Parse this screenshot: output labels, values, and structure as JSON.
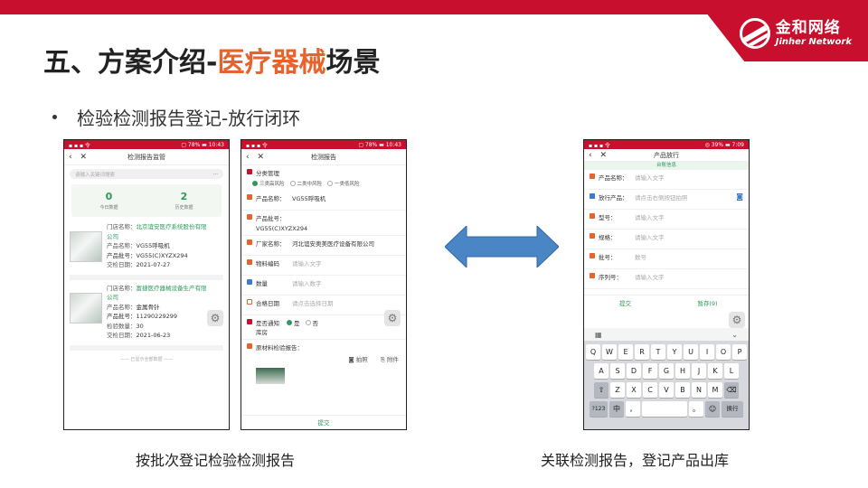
{
  "logo": {
    "cn": "金和网络",
    "en": "Jinher Network"
  },
  "title": {
    "prefix": "五、方案介绍-",
    "accent": "医疗器械",
    "suffix": "场景"
  },
  "bullet": "检验检测报告登记-放行闭环",
  "phone1": {
    "status_left": "▪ ▪ ▪ 令",
    "status_right": "▢ 78% ▬ 10:43",
    "nav_title": "检测报告监管",
    "search_placeholder": "请输入关键词搜索",
    "more": "···",
    "stats": [
      {
        "num": "0",
        "label": "今日数据"
      },
      {
        "num": "2",
        "label": "历史数据"
      }
    ],
    "records": [
      {
        "store_k": "门店名称：",
        "store_v": "北京谊安医疗系统股份有限",
        "store_v2": "公司",
        "name_k": "产品名称：",
        "name_v": "VG55呼吸机",
        "batch_k": "产品批号：",
        "batch_v": "VG55(C)XYZX294",
        "date_k": "交检日期：",
        "date_v": "2021-07-27"
      },
      {
        "store_k": "门店名称：",
        "store_v": "富捷医疗器械设备生产有限",
        "store_v2": "公司",
        "name_k": "产品名称：",
        "name_v": "金属骨针",
        "batch_k": "产品批号：",
        "batch_v": "11290229299",
        "qty_k": "检验数量：",
        "qty_v": "30",
        "date_k": "交检日期：",
        "date_v": "2021-06-23"
      }
    ],
    "end_text": "—— 已显示全部数据 ——"
  },
  "phone2": {
    "status_left": "▪ ▪ ▪ 令",
    "status_right": "▢ 78% ▬ 10:43",
    "nav_title": "检测报告",
    "category_label": "分类管理",
    "radios": [
      "三类高风险",
      "二类中风险",
      "一类低风险"
    ],
    "rows": [
      {
        "label": "产品名称：",
        "value": "VG55呼吸机"
      },
      {
        "label": "产品批号：",
        "value": "VG55(C)XYZX294"
      },
      {
        "label": "厂家名称：",
        "value": "河北谊安奥美医疗设备有限公司"
      },
      {
        "label": "物料编码",
        "placeholder": "请输入文字"
      },
      {
        "label": "数量",
        "placeholder": "请输入数字"
      },
      {
        "label": "合格日期",
        "placeholder": "请点击选择日期"
      }
    ],
    "notify_label": "是否通知库房",
    "notify_yes": "是",
    "notify_no": "否",
    "material_label": "原材料检验报告：",
    "photo": "拍照",
    "attach": "附件",
    "submit": "提交"
  },
  "phone3": {
    "status_left": "▪ ▪ ▪ 令",
    "status_right": "◎ 39% ▬ 7:09",
    "nav_title": "产品放行",
    "banner": "台账信息",
    "rows": [
      {
        "label": "产品名称：",
        "placeholder": "请输入文字"
      },
      {
        "label": "放行产品：",
        "placeholder": "请点击右侧按钮拍照"
      },
      {
        "label": "型号：",
        "placeholder": "请输入文字"
      },
      {
        "label": "规格：",
        "placeholder": "请输入文字"
      },
      {
        "label": "批号：",
        "placeholder": "数号"
      },
      {
        "label": "序列号：",
        "placeholder": "请输入文字"
      }
    ],
    "submit": "提交",
    "save": "暂存(9)",
    "keyboard": {
      "row1": [
        "Q",
        "W",
        "E",
        "R",
        "T",
        "Y",
        "U",
        "I",
        "O",
        "P"
      ],
      "row2": [
        "A",
        "S",
        "D",
        "F",
        "G",
        "H",
        "J",
        "K",
        "L"
      ],
      "row3": [
        "Z",
        "X",
        "C",
        "V",
        "B",
        "N",
        "M"
      ],
      "bottom": [
        "?123",
        "中",
        "，",
        "",
        "。",
        "☺",
        "换行"
      ]
    }
  },
  "captions": {
    "left": "按批次登记检验检测报告",
    "right": "关联检测报告，登记产品出库"
  },
  "colors": {
    "brand_red": "#c8102e",
    "accent_orange": "#e8632b",
    "green": "#2e9a5a",
    "arrow_blue": "#4a86c5"
  }
}
